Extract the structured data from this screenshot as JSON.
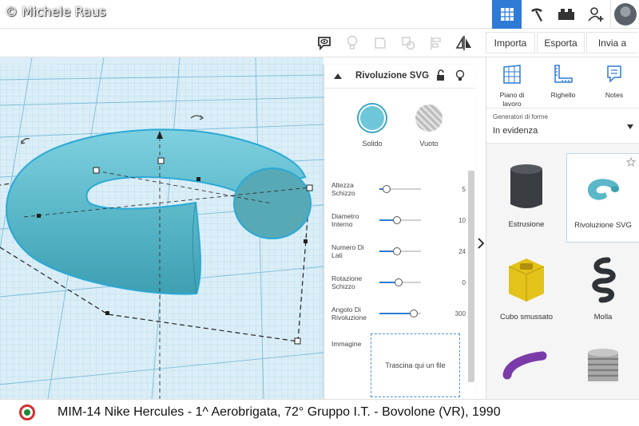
{
  "watermark": "© Michele Raus",
  "toolbar": {
    "import_label": "Importa",
    "export_label": "Esporta",
    "send_label": "Invia a"
  },
  "inspector": {
    "title": "Rivoluzione SVG",
    "solid_label": "Solido",
    "hole_label": "Vuoto",
    "params": [
      {
        "label": "Altezza\nSchizzo",
        "value": "5",
        "fraction": 0.18
      },
      {
        "label": "Diametro\nInterno",
        "value": "10",
        "fraction": 0.42
      },
      {
        "label": "Numero Di\nLati",
        "value": "24",
        "fraction": 0.42
      },
      {
        "label": "Rotazione\nSchizzo",
        "value": "0",
        "fraction": 0.47
      },
      {
        "label": "Angolo Di\nRivoluzione",
        "value": "300",
        "fraction": 0.83
      }
    ],
    "image_label": "Immagine",
    "dropzone_text": "Trascina qui un file"
  },
  "panel": {
    "tabs": [
      {
        "label": "Piano di\nlavoro",
        "icon": "workplane-icon"
      },
      {
        "label": "Righello",
        "icon": "ruler-icon"
      },
      {
        "label": "Notes",
        "icon": "notes-icon"
      }
    ],
    "generator_label": "Generatori di forme",
    "generator_value": "In evidenza",
    "shapes": [
      {
        "name": "Estrusione",
        "color": "#3a3d42"
      },
      {
        "name": "Rivoluzione SVG",
        "color": "#5ab8c9"
      },
      {
        "name": "Cubo smussato",
        "color": "#e3c21a"
      },
      {
        "name": "Molla",
        "color": "#2f3338"
      },
      {
        "name": "",
        "color": "#7a3aa8"
      },
      {
        "name": "",
        "color": "#a9a9a9"
      }
    ]
  },
  "caption": "MIM-14 Nike Hercules - 1^ Aerobrigata, 72° Gruppo I.T. - Bovolone (VR), 1990",
  "colors": {
    "accent": "#2d7bd5",
    "model": "#5ab8c9",
    "workplane": "#dbeef7"
  }
}
